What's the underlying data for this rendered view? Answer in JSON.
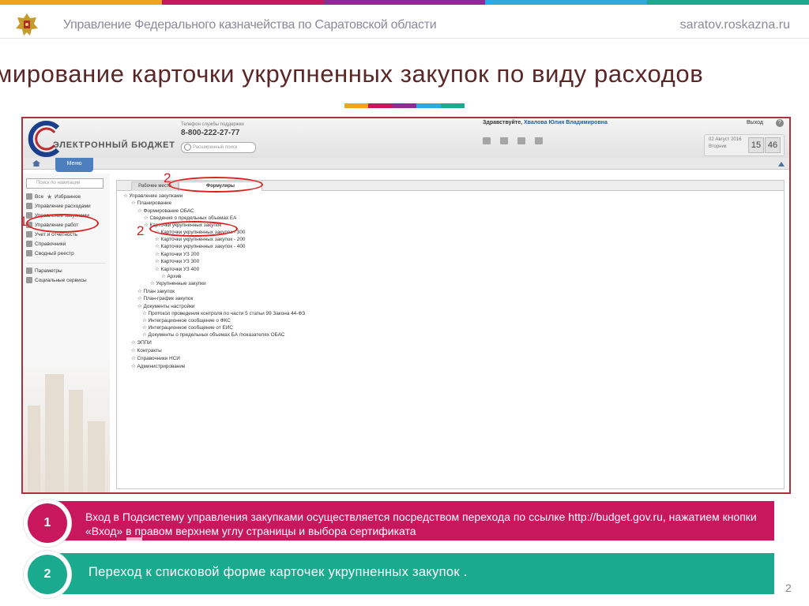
{
  "colors": {
    "top_bar": [
      "#f4a21c",
      "#c8175d",
      "#8d2d90",
      "#2ba9e0",
      "#1aaa8e"
    ],
    "title": "#5a2626",
    "box1": "#c8175d",
    "box2": "#1aaa8e",
    "annotation": "#e02020"
  },
  "header": {
    "title": "Управление Федерального казначейства по Саратовской области",
    "site": "saratov.roskazna.ru"
  },
  "slide": {
    "title": "мирование карточки укрупненных закупок по виду расходов",
    "page_number": "2"
  },
  "app": {
    "logo_text": "ЭЛЕКТРОННЫЙ БЮДЖЕТ",
    "phone_label": "Телефон службы поддержки",
    "phone": "8-800-222-27-77",
    "search_placeholder": "Расширенный поиск",
    "greeting": "Здравствуйте,",
    "user_name": "Хвалова Юлия Владимировна",
    "exit_label": "Выход",
    "help_label": "?",
    "date": "02 Август 2016",
    "weekday": "Вторник",
    "time_h": "15",
    "time_m": "46",
    "menu_label": "Меню"
  },
  "sidebar": {
    "search_placeholder": "Поиск по навигации",
    "items": [
      {
        "label": "Все",
        "icon": "grid-icon"
      },
      {
        "label": "Избранное",
        "icon": "star-icon"
      },
      {
        "label": "Управление расходами",
        "icon": "coins-icon"
      },
      {
        "label": "Управление закупками",
        "icon": "edit-icon"
      },
      {
        "label": "Управление работ",
        "icon": "folder-icon"
      },
      {
        "label": "Учет и отчетность",
        "icon": "report-icon"
      },
      {
        "label": "Справочники",
        "icon": "book-icon"
      },
      {
        "label": "Сводный реестр",
        "icon": "registry-icon"
      },
      {
        "label": "Параметры",
        "icon": "tools-icon"
      },
      {
        "label": "Социальные сервисы",
        "icon": "people-icon"
      }
    ]
  },
  "tabs": [
    {
      "label": "Рабочее место"
    },
    {
      "label": "Формуляры"
    }
  ],
  "tree": [
    {
      "label": "Управление закупками",
      "level": 0
    },
    {
      "label": "Планирование",
      "level": 1
    },
    {
      "label": "Формирование ОБАС",
      "level": 2
    },
    {
      "label": "Сведения о предельных объемах ЕА",
      "level": 3
    },
    {
      "label": "Карточки укрупненных закупок",
      "level": 3
    },
    {
      "label": "Карточки укрупненных закупок - 300",
      "level": 4
    },
    {
      "label": "Карточки укрупненных закупок - 200",
      "level": 4
    },
    {
      "label": "Карточки укрупненных закупок - 400",
      "level": 4
    },
    {
      "label": "Карточки УЗ 200",
      "level": 4
    },
    {
      "label": "Карточки УЗ 300",
      "level": 4
    },
    {
      "label": "Карточки УЗ 400",
      "level": 4
    },
    {
      "label": "Архив",
      "level": 4
    },
    {
      "label": "Укрупненные закупки",
      "level": 3
    },
    {
      "label": "План закупок",
      "level": 2
    },
    {
      "label": "План-график закупок",
      "level": 2
    },
    {
      "label": "Документы настройки",
      "level": 2
    },
    {
      "label": "Протокол проведения контроля по части 5 статьи 99 Закона 44-ФЗ",
      "level": 3
    },
    {
      "label": "Интеграционное сообщение о ФКС",
      "level": 3
    },
    {
      "label": "Интеграционное сообщение от ЕИС",
      "level": 3
    },
    {
      "label": "Документы о предельных объемах БА /показателях ОБАС",
      "level": 3
    },
    {
      "label": "ЭППИ",
      "level": 1
    },
    {
      "label": "Контракты",
      "level": 1
    },
    {
      "label": "Справочники НСИ",
      "level": 1
    },
    {
      "label": "Администрирование",
      "level": 1
    }
  ],
  "annotations": {
    "marker_1": "1",
    "marker_2a": "2",
    "marker_2b": "2"
  },
  "steps": [
    {
      "number": "1",
      "text": "Вход в Подсистему управления закупками осуществляется посредством перехода по ссылке http://budget.gov.ru, нажатием кнопки «Вход» в правом верхнем углу страницы и выбора сертификата"
    },
    {
      "number": "2",
      "text": "Переход к списковой форме карточек укрупненных закупок ."
    }
  ]
}
